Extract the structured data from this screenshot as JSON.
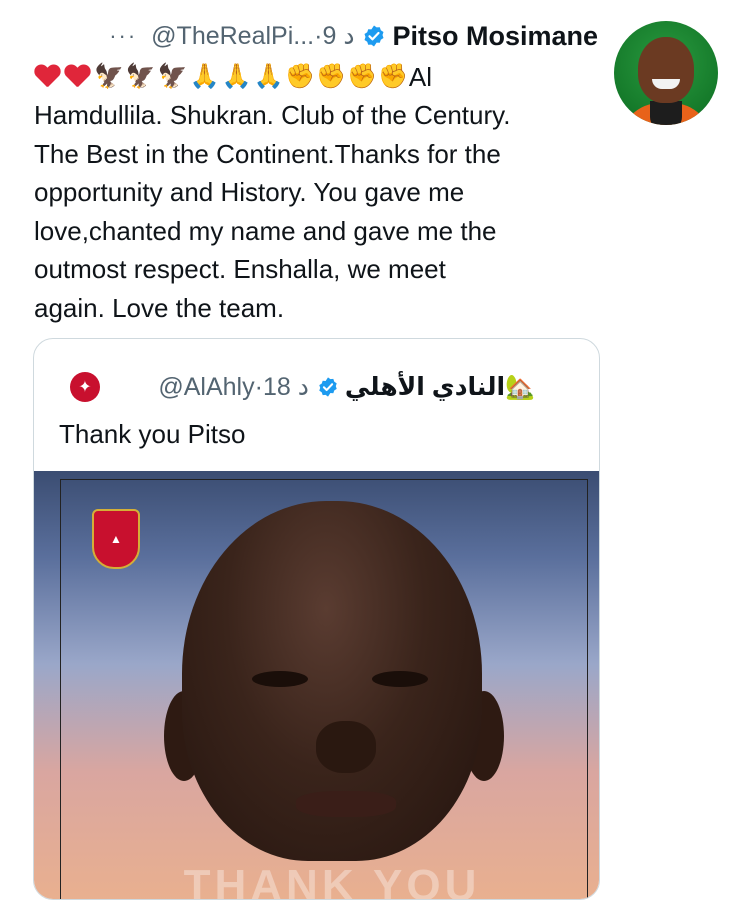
{
  "tweet": {
    "more_icon": "···",
    "time": "9 د",
    "separator": "·",
    "handle": "@TheRealPi...",
    "author": "Pitso Mosimane",
    "verified_color": "#1d9bf0",
    "emoji_lead_text": "Al",
    "text_lines": [
      "Hamdullila. Shukran. Club of the Century.",
      "The Best  in the Continent.Thanks for the",
      "opportunity and History. You gave me",
      "love,chanted my name and gave me the",
      "outmost respect. Enshalla, we meet",
      "again. Love the team."
    ]
  },
  "quote": {
    "author": "النادي الأهلي",
    "handle": "@AlAhly",
    "separator": "·",
    "time": "18 د",
    "text": "Thank you Pitso",
    "media_caption": "THANK YOU"
  },
  "colors": {
    "text": "#0f1419",
    "secondary": "#536471",
    "border": "#cfd9de",
    "club_red": "#c8102e"
  }
}
